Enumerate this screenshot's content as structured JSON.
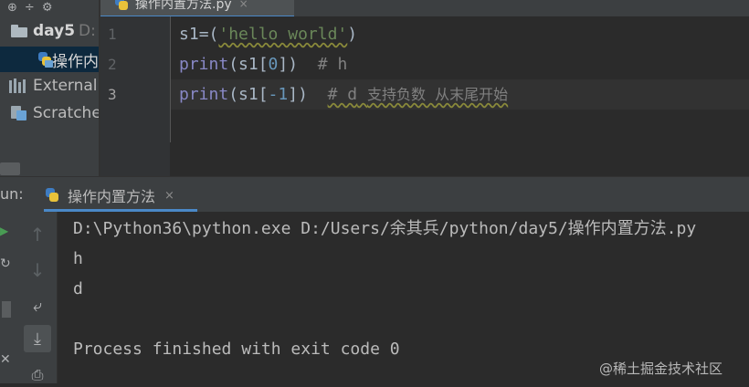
{
  "project_panel": {
    "toolbar_glyph_1": "⊕",
    "toolbar_glyph_2": "÷",
    "toolbar_glyph_3": "⚙",
    "folder": {
      "name": "day5",
      "path_fragment": "D:"
    },
    "file": {
      "name": "操作内"
    },
    "external": "External",
    "scratches": "Scratche"
  },
  "editor": {
    "tab_label": "操作内置方法.py",
    "tab_close": "×",
    "line_numbers": [
      "1",
      "2",
      "3"
    ],
    "lines": [
      {
        "var": "s1",
        "op": "=(",
        "str": "'hello world'",
        "close": ")"
      },
      {
        "fn": "print",
        "open": "(s1[",
        "num": "0",
        "close": "])",
        "comment": "# h"
      },
      {
        "fn": "print",
        "open": "(s1[",
        "neg": "-",
        "num": "1",
        "close": "])",
        "comment_hash": "# d",
        "comment_text": "支持负数  从末尾开始"
      }
    ]
  },
  "run_panel": {
    "label": "un:",
    "tab_label": "操作内置方法",
    "tab_close": "×",
    "tools": {
      "up": "↑",
      "down": "↓",
      "wrap": "⤶",
      "scroll_end": "⤓",
      "print": "⎙",
      "run": "▶",
      "rerun": "↻",
      "close": "✕"
    },
    "output": {
      "command": "D:\\Python36\\python.exe D:/Users/余其兵/python/day5/操作内置方法.py",
      "line_1": "h",
      "line_2": "d",
      "exit": "Process finished with exit code 0"
    }
  },
  "watermark": "@稀土掘金技术社区",
  "colors": {
    "accent": "#4a88c7",
    "editor_bg": "#2b2b2b",
    "panel_bg": "#3c3f41",
    "string": "#6a8759",
    "number": "#6897bb",
    "comment": "#808080",
    "builtin": "#8888c6"
  }
}
